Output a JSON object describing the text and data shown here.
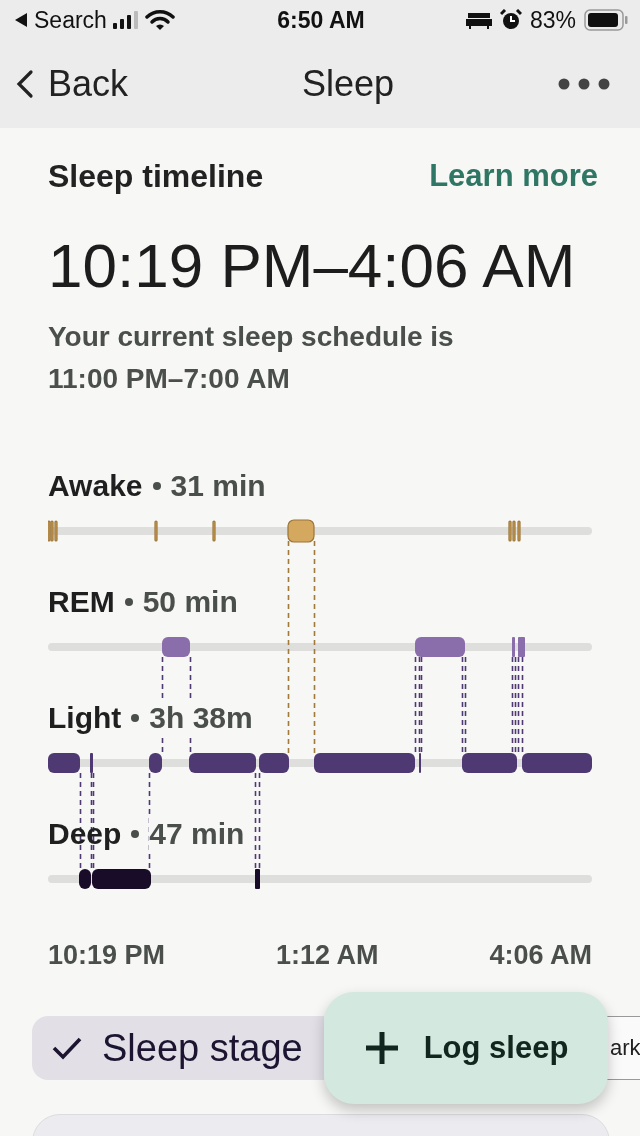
{
  "status_bar": {
    "back_app": "Search",
    "time": "6:50 AM",
    "battery": "83%"
  },
  "nav": {
    "back": "Back",
    "title": "Sleep"
  },
  "timeline": {
    "title": "Sleep timeline",
    "link": "Learn more",
    "range": "10:19 PM–4:06 AM",
    "schedule": "Your current sleep schedule is 11:00 PM–7:00 AM"
  },
  "stages": [
    {
      "name": "Awake",
      "duration": "31 min",
      "color": "#d4a95f"
    },
    {
      "name": "REM",
      "duration": "50 min",
      "color": "#8a6dab"
    },
    {
      "name": "Light",
      "duration": "3h 38m",
      "color": "#4f3972"
    },
    {
      "name": "Deep",
      "duration": "47 min",
      "color": "#180c28"
    }
  ],
  "axis_labels": [
    "10:19 PM",
    "1:12 AM",
    "4:06 AM"
  ],
  "chips": [
    {
      "label": "Sleep stage",
      "selected": true
    },
    {
      "label": "ark",
      "selected": false
    }
  ],
  "fab": {
    "label": "Log sleep"
  }
}
